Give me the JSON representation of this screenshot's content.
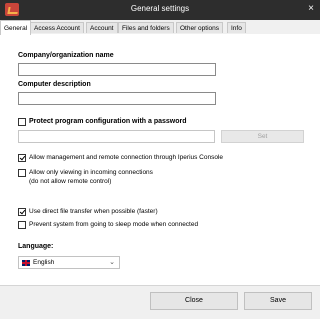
{
  "window": {
    "title": "General settings",
    "close_glyph": "×"
  },
  "tabs": [
    "General",
    "Access Account",
    "Account",
    "Files and folders",
    "Other options",
    "Info"
  ],
  "general": {
    "company_label": "Company/organization name",
    "company_value": "",
    "description_label": "Computer description",
    "description_value": "",
    "protect_label": "Protect program configuration with a password",
    "protect_checked": false,
    "password_value": "",
    "set_button": "Set",
    "allow_management_label": "Allow management and remote connection through Iperius Console",
    "allow_management_checked": true,
    "allow_view_label_line1": "Allow only viewing in incoming connections",
    "allow_view_label_line2": "(do not allow remote control)",
    "allow_view_checked": false,
    "direct_transfer_label": "Use direct file transfer when possible (faster)",
    "direct_transfer_checked": true,
    "prevent_sleep_label": "Prevent system from going to sleep mode when connected",
    "prevent_sleep_checked": false,
    "language_label": "Language:",
    "language_value": "English",
    "language_flag_icon": "uk-flag-icon"
  },
  "footer": {
    "close_button": "Close",
    "save_button": "Save"
  }
}
